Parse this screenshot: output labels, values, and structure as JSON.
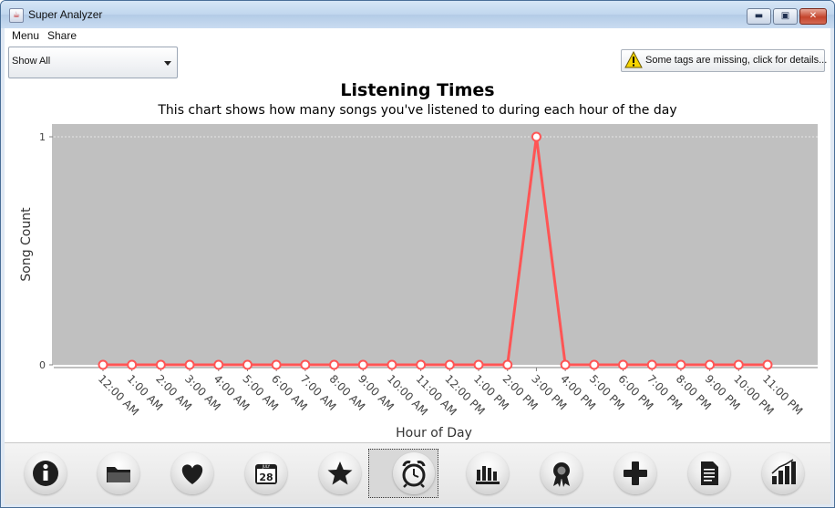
{
  "window": {
    "title": "Super Analyzer",
    "minimize_label": "▬",
    "maximize_label": "▣",
    "close_label": "✕"
  },
  "menu": {
    "items": [
      "Menu",
      "Share"
    ]
  },
  "filter": {
    "selected": "Show All"
  },
  "warning": {
    "label": "Some tags are missing, click for details..."
  },
  "colors": {
    "plot_bg": "#c0c0c0",
    "series": "#ff5555",
    "accent_warning": "#f5d400"
  },
  "chart_data": {
    "type": "line",
    "title": "Listening Times",
    "subtitle": "This chart shows how many songs you've listened to during each hour of the day",
    "xlabel": "Hour of Day",
    "ylabel": "Song Count",
    "ylim": [
      0,
      1
    ],
    "yticks": [
      "0",
      "1"
    ],
    "grid": true,
    "categories": [
      "12:00 AM",
      "1:00 AM",
      "2:00 AM",
      "3:00 AM",
      "4:00 AM",
      "5:00 AM",
      "6:00 AM",
      "7:00 AM",
      "8:00 AM",
      "9:00 AM",
      "10:00 AM",
      "11:00 AM",
      "12:00 PM",
      "1:00 PM",
      "2:00 PM",
      "3:00 PM",
      "4:00 PM",
      "5:00 PM",
      "6:00 PM",
      "7:00 PM",
      "8:00 PM",
      "9:00 PM",
      "10:00 PM",
      "11:00 PM"
    ],
    "values": [
      0,
      0,
      0,
      0,
      0,
      0,
      0,
      0,
      0,
      0,
      0,
      0,
      0,
      0,
      0,
      1,
      0,
      0,
      0,
      0,
      0,
      0,
      0,
      0
    ]
  },
  "toolbar": {
    "buttons": [
      {
        "icon": "info-icon",
        "selected": false
      },
      {
        "icon": "folder-icon",
        "selected": false
      },
      {
        "icon": "heart-icon",
        "selected": false
      },
      {
        "icon": "calendar-icon",
        "selected": false,
        "text": "28",
        "subtext": "JULY"
      },
      {
        "icon": "star-icon",
        "selected": false
      },
      {
        "icon": "alarm-clock-icon",
        "selected": true
      },
      {
        "icon": "bars-chart-icon",
        "selected": false
      },
      {
        "icon": "award-ribbon-icon",
        "selected": false
      },
      {
        "icon": "plus-icon",
        "selected": false
      },
      {
        "icon": "document-icon",
        "selected": false
      },
      {
        "icon": "bar-graph-icon",
        "selected": false
      }
    ]
  }
}
